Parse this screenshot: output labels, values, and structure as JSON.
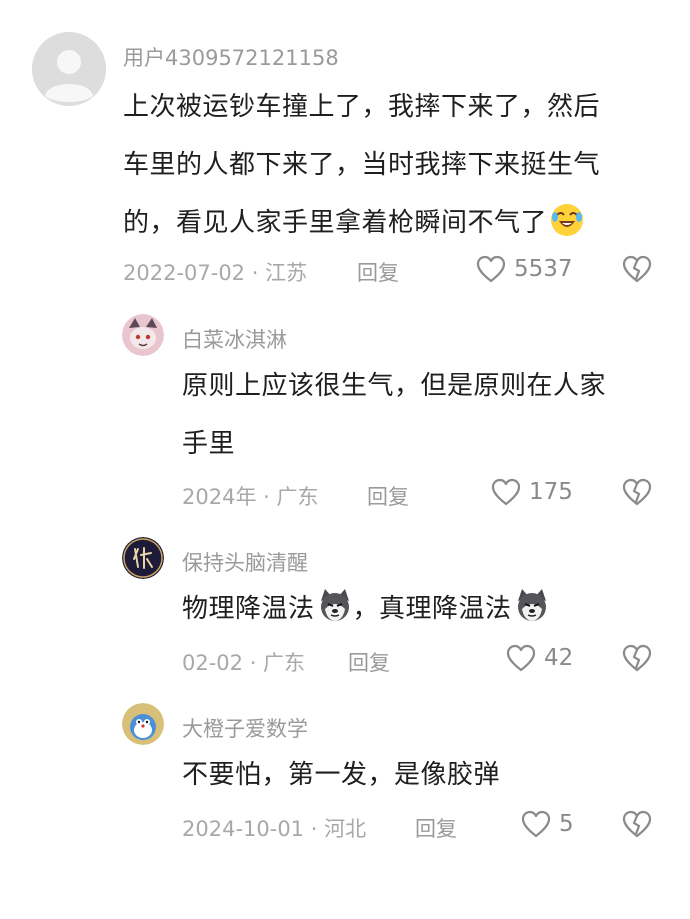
{
  "comments": [
    {
      "username": "用户4309572121158",
      "lines": [
        "上次被运钞车撞上了，我摔下来了，然后",
        "车里的人都下来了，当时我摔下来挺生气",
        "的，看见人家手里拿着枪瞬间不气了"
      ],
      "emoji_after_last_line": "crying-laughing-emoji",
      "meta": "2022-07-02 · 江苏",
      "reply_label": "回复",
      "likes": "5537"
    },
    {
      "username": "白菜冰淇淋",
      "lines": [
        "原则上应该很生气，但是原则在人家",
        "手里"
      ],
      "meta": "2024年 · 广东",
      "reply_label": "回复",
      "likes": "175"
    },
    {
      "username": "保持头脑清醒",
      "parts": [
        "物理降温法",
        "，真理降温法"
      ],
      "emoji_name": "husky-dog-emoji",
      "meta": "02-02 · 广东",
      "reply_label": "回复",
      "likes": "42"
    },
    {
      "username": "大橙子爱数学",
      "lines": [
        "不要怕，第一发，是像胶弹"
      ],
      "meta": "2024-10-01 · 河北",
      "reply_label": "回复",
      "likes": "5"
    }
  ],
  "icons": {
    "like": "heart-outline-icon",
    "dislike": "broken-heart-icon"
  },
  "colors": {
    "text": "#1f1f1f",
    "secondary": "#9a9a9a",
    "icon": "#8a8a8a"
  }
}
